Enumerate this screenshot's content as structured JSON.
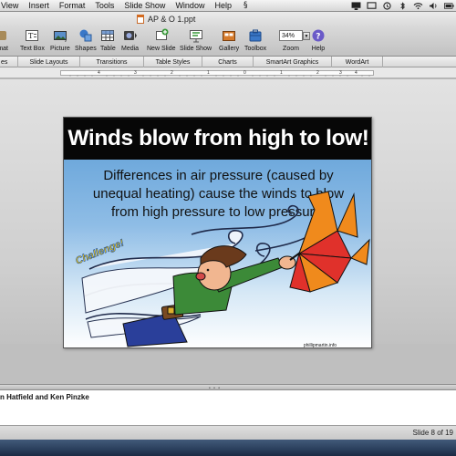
{
  "menubar": {
    "items": [
      "View",
      "Insert",
      "Format",
      "Tools",
      "Slide Show",
      "Window",
      "Help"
    ],
    "script_glyph": "§"
  },
  "window": {
    "title": "AP & O 1.ppt"
  },
  "toolbar": {
    "items": [
      {
        "label": "rmat",
        "icon": "format-icon"
      },
      {
        "label": "Text Box",
        "icon": "text-box-icon"
      },
      {
        "label": "Picture",
        "icon": "picture-icon"
      },
      {
        "label": "Shapes",
        "icon": "shapes-icon"
      },
      {
        "label": "Table",
        "icon": "table-icon"
      },
      {
        "label": "Media",
        "icon": "media-icon"
      },
      {
        "label": "New Slide",
        "icon": "new-slide-icon"
      },
      {
        "label": "Slide Show",
        "icon": "slide-show-icon"
      },
      {
        "label": "Gallery",
        "icon": "gallery-icon"
      },
      {
        "label": "Toolbox",
        "icon": "toolbox-icon"
      },
      {
        "label": "Zoom",
        "icon": "zoom-icon"
      },
      {
        "label": "Help",
        "icon": "help-icon"
      }
    ],
    "zoom_value": "34%"
  },
  "ribbon": {
    "tabs": [
      "es",
      "Slide Layouts",
      "Transitions",
      "Table Styles",
      "Charts",
      "SmartArt Graphics",
      "WordArt"
    ]
  },
  "ruler": {
    "labels": [
      "4",
      "3",
      "2",
      "1",
      "0",
      "1",
      "2",
      "3",
      "4"
    ]
  },
  "slide": {
    "title": "Winds blow from high to low!",
    "body_lines": [
      "Differences in air pressure (caused by",
      "unequal heating) cause the winds to blow",
      "from high pressure to low pressure."
    ],
    "badge": "Challenge!",
    "credit": "phillipmartin.info"
  },
  "notes": {
    "text": "n Hatfield and Ken Pinzke"
  },
  "status": {
    "slide_count": "Slide 8 of 19"
  },
  "colors": {
    "title_bg": "#070707",
    "body_gradient_top": "#6fa9dc",
    "umbrella_red": "#e0312b",
    "umbrella_orange": "#f08a1c"
  }
}
